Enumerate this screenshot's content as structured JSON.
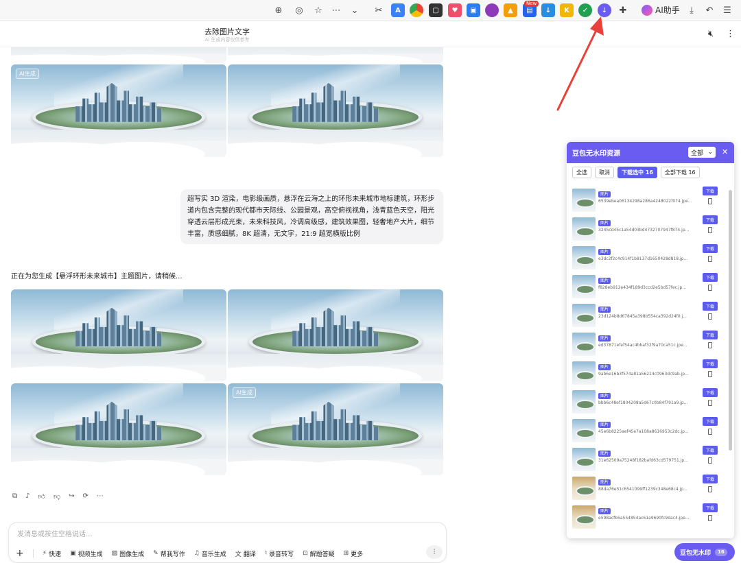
{
  "toolbar": {
    "icons": [
      "zoom-icon",
      "location-icon",
      "star-icon",
      "more-icon",
      "chevron-down-icon",
      "cut-icon",
      "translate-icon",
      "color-circle-icon",
      "reader-icon",
      "pocket-icon",
      "screenshot-icon",
      "media-icon",
      "image-icon",
      "new-ext-icon",
      "download-icon",
      "kangaroo-icon",
      "green-ext-icon",
      "purple-download-ext-icon",
      "puzzle-icon"
    ],
    "new_badge": "New",
    "ai_label": "AI助手"
  },
  "header": {
    "title": "去除图片文字",
    "subtitle": "AI 生成内容仅供参考"
  },
  "chat": {
    "watermark": "AI生成",
    "user_prompt": "超写实 3D 渲染，电影级画质，悬浮在云海之上的环形未来城市地标建筑，环形步道内包含完整的现代都市天际线、公园景观，高空俯视视角，浅青蓝色天空，阳光穿透云层形成光束，未来科技风，冷调高级感，建筑效果图，轻奢地产大片，细节丰富，质感细腻，8K 超清，无文字，21:9 超宽横版比例",
    "generating_text": "正在为您生成【悬浮环形未来城市】主题图片，请稍候..."
  },
  "input": {
    "placeholder": "发消息或按住空格说话...",
    "tools": [
      {
        "icon": "lightning-icon",
        "label": "快速"
      },
      {
        "icon": "video-icon",
        "label": "视频生成"
      },
      {
        "icon": "image-icon",
        "label": "图像生成"
      },
      {
        "icon": "pen-icon",
        "label": "帮我写作"
      },
      {
        "icon": "music-icon",
        "label": "音乐生成"
      },
      {
        "icon": "translate-icon",
        "label": "翻译"
      },
      {
        "icon": "mic-icon",
        "label": "录音转写"
      },
      {
        "icon": "answer-icon",
        "label": "解题答疑"
      },
      {
        "icon": "more-grid-icon",
        "label": "更多"
      }
    ]
  },
  "panel": {
    "title": "豆包无水印资源",
    "select_value": "全部",
    "tabs": {
      "select_all": "全选",
      "cancel": "取消",
      "download_selected": "下载选中 16",
      "download_all": "全部下载 16"
    },
    "tag_label": "图片",
    "download_label": "下载",
    "items": [
      {
        "name": "6539ebea06134298a286a4248022f074.jpe..."
      },
      {
        "name": "3245cd45c1a54d03bd4732707947f874.jp..."
      },
      {
        "name": "e3dc2f2c4c914f1b8137d1650428d818.jp..."
      },
      {
        "name": "f828eb912e434f189d3ccd2e5bd57fec.jp..."
      },
      {
        "name": "23d124b8d67845a398b554ca392d24f0.j..."
      },
      {
        "name": "ed37871efef54ac4bbaf32f9a70ca51c.jpe..."
      },
      {
        "name": "9ab6e16b3f574a81a56214c0963dc9ab.jp..."
      },
      {
        "name": "bbb6c48ef1804208a5d67c0b84f791a9.jp..."
      },
      {
        "name": "45e6b8225aef45e7a108a8616953c2dc.jp..."
      },
      {
        "name": "31e62509a75248f182bafd63cd579751.jp..."
      },
      {
        "name": "88da76e51c6541099ff1239c348e68c4.jp..."
      },
      {
        "name": "e598acfb5a554854ac61a9690fc9dac4.jpe..."
      }
    ]
  },
  "float_button": {
    "label": "豆包无水印",
    "count": "16"
  },
  "colors": {
    "accent": "#6a5cf0",
    "arrow": "#e8413a"
  }
}
